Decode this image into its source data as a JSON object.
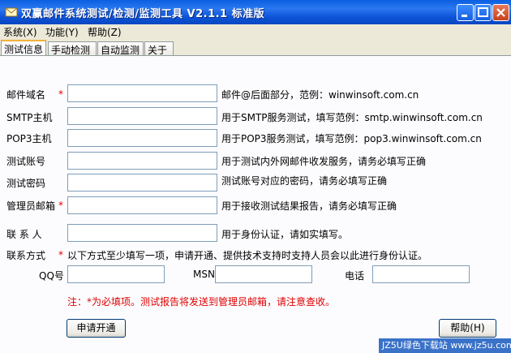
{
  "window": {
    "title": "双赢邮件系统测试/检测/监测工具 V2.1.1 标准版"
  },
  "menu": [
    "系统(X)",
    "功能(Y)",
    "帮助(Z)"
  ],
  "tabs": [
    "测试信息",
    "手动检测",
    "自动监测",
    "关于"
  ],
  "form": {
    "domain": {
      "label": "邮件域名",
      "required": "*",
      "value": "",
      "hint": "邮件@后面部分，范例：winwinsoft.com.cn"
    },
    "smtp": {
      "label": "SMTP主机",
      "value": "",
      "hint": "用于SMTP服务测试，填写范例：smtp.winwinsoft.com.cn"
    },
    "pop3": {
      "label": "POP3主机",
      "value": "",
      "hint": "用于POP3服务测试，填写范例：pop3.winwinsoft.com.cn"
    },
    "account": {
      "label": "测试账号",
      "value": "",
      "hint": "用于测试内外网邮件收发服务，请务必填写正确"
    },
    "password": {
      "label": "测试密码",
      "value": "",
      "hint": "测试账号对应的密码，请务必填写正确"
    },
    "admin_email": {
      "label": "管理员邮箱",
      "required": "*",
      "value": "",
      "hint": "用于接收测试结果报告，请务必填写正确"
    },
    "contact": {
      "label": "联 系 人",
      "value": "",
      "hint": "用于身份认证，请如实填写。"
    },
    "contact_method": {
      "label": "联系方式",
      "required": "*",
      "note": "以下方式至少填写一项，申请开通、提供技术支持时支持人员会以此进行身份认证。"
    },
    "qq": {
      "label": "QQ号",
      "value": ""
    },
    "msn": {
      "label": "MSN",
      "value": ""
    },
    "phone": {
      "label": "电话",
      "value": ""
    }
  },
  "footnote": {
    "prefix": "注：",
    "star": "*",
    "text": "为必填项。测试报告将发送到管理员邮箱，请注意查收。"
  },
  "buttons": {
    "apply": "申请开通",
    "help": "帮助(H)"
  },
  "watermark": "JZ5U绿色下载站 www.jz5u.com"
}
